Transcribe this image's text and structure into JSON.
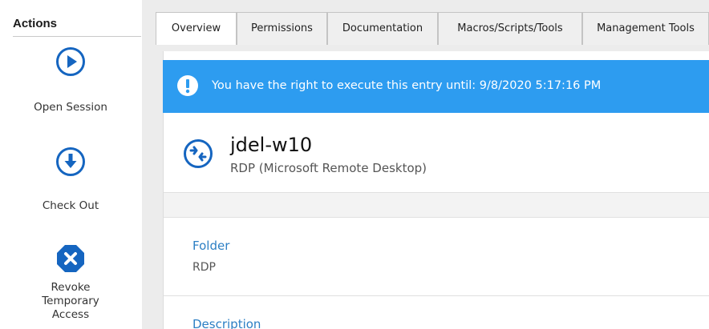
{
  "sidebar": {
    "title": "Actions",
    "actions": [
      {
        "label": "Open Session",
        "icon": "play-circle-icon"
      },
      {
        "label": "Check Out",
        "icon": "download-circle-icon"
      },
      {
        "label_lines": [
          "Revoke",
          "Temporary",
          "Access"
        ],
        "icon": "close-octagon-icon"
      }
    ]
  },
  "tabs": [
    {
      "label": "Overview",
      "active": true
    },
    {
      "label": "Permissions",
      "active": false
    },
    {
      "label": "Documentation",
      "active": false
    },
    {
      "label": "Macros/Scripts/Tools",
      "active": false
    },
    {
      "label": "Management Tools",
      "active": false
    }
  ],
  "banner": {
    "icon": "exclamation-circle-icon",
    "text": "You have the right to execute this entry until: 9/8/2020 5:17:16 PM"
  },
  "entry": {
    "icon": "rdp-icon",
    "name": "jdel-w10",
    "type": "RDP (Microsoft Remote Desktop)"
  },
  "fields": [
    {
      "label": "Folder",
      "value": "RDP"
    },
    {
      "label": "Description",
      "value": ""
    }
  ],
  "colors": {
    "accent": "#2d9cf0",
    "icon_blue": "#1565c0",
    "link_blue": "#2c7fc4"
  }
}
